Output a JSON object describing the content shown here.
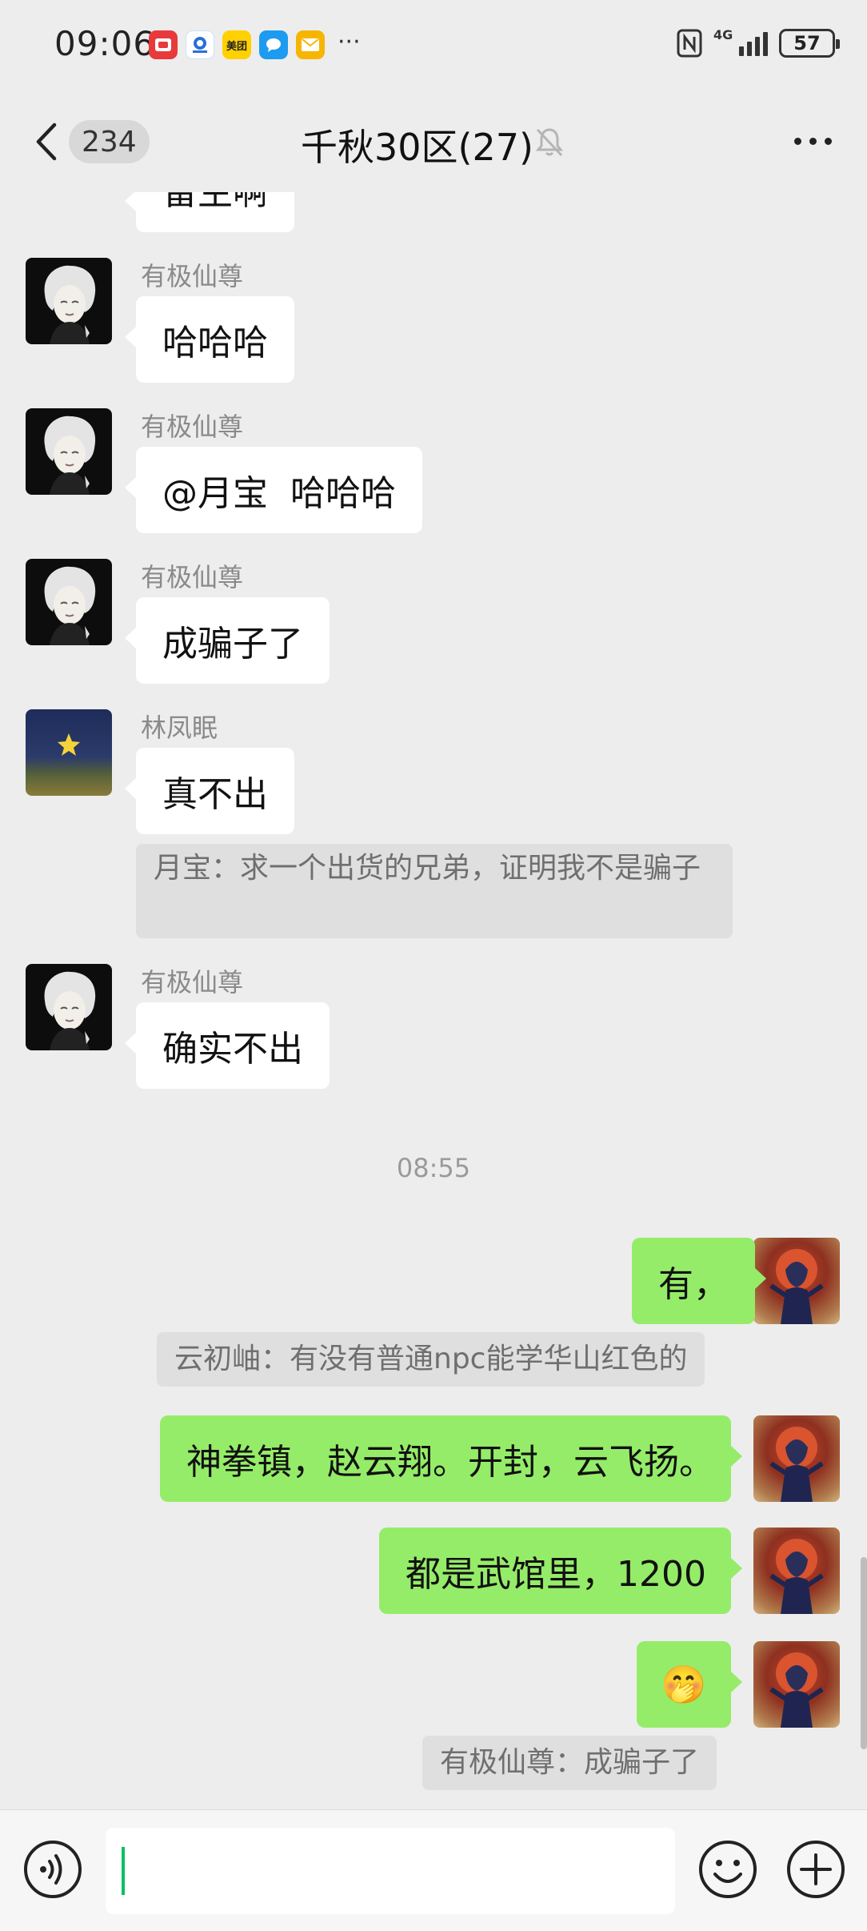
{
  "status_bar": {
    "time": "09:06",
    "apps": [
      {
        "icon": "red-app-icon",
        "label": "",
        "color": "#e83a3a"
      },
      {
        "icon": "blue-bird-app-icon",
        "label": "",
        "color": "#2a6fd6"
      },
      {
        "icon": "meituan-icon",
        "label": "美团",
        "color": "#ffd100"
      },
      {
        "icon": "chat-bubble-app-icon",
        "label": "",
        "color": "#1d9bf0"
      },
      {
        "icon": "mail-app-icon",
        "label": "",
        "color": "#f7b500"
      }
    ],
    "more": "···",
    "network": "4G",
    "battery": "57"
  },
  "nav": {
    "unread_count": "234",
    "title": "千秋30区(27)"
  },
  "messages": {
    "m1": {
      "text": "留生啊"
    },
    "m2": {
      "sender": "有极仙尊",
      "text": "哈哈哈"
    },
    "m3": {
      "sender": "有极仙尊",
      "text": "@月宝  哈哈哈"
    },
    "m4": {
      "sender": "有极仙尊",
      "text": "成骗子了"
    },
    "m5": {
      "sender": "林凤眠",
      "text": "真不出"
    },
    "q5": {
      "text": "月宝：求一个出货的兄弟，证明我不是骗子"
    },
    "m6": {
      "sender": "有极仙尊",
      "text": "确实不出"
    },
    "time": "08:55",
    "r1": {
      "text": "有，"
    },
    "q1": {
      "text": "云初岫：有没有普通npc能学华山红色的"
    },
    "r2": {
      "text": "神拳镇，赵云翔。开封，云飞扬。"
    },
    "r3": {
      "text": "都是武馆里，1200"
    },
    "r4": {
      "emoji": "🤭"
    },
    "q4": {
      "text": "有极仙尊：成骗子了"
    }
  },
  "input": {
    "value": ""
  },
  "colors": {
    "background": "#ededed",
    "incoming_bubble": "#ffffff",
    "outgoing_bubble": "#95ec69",
    "quote_bg": "#dfdfdf",
    "accent": "#07c160"
  }
}
